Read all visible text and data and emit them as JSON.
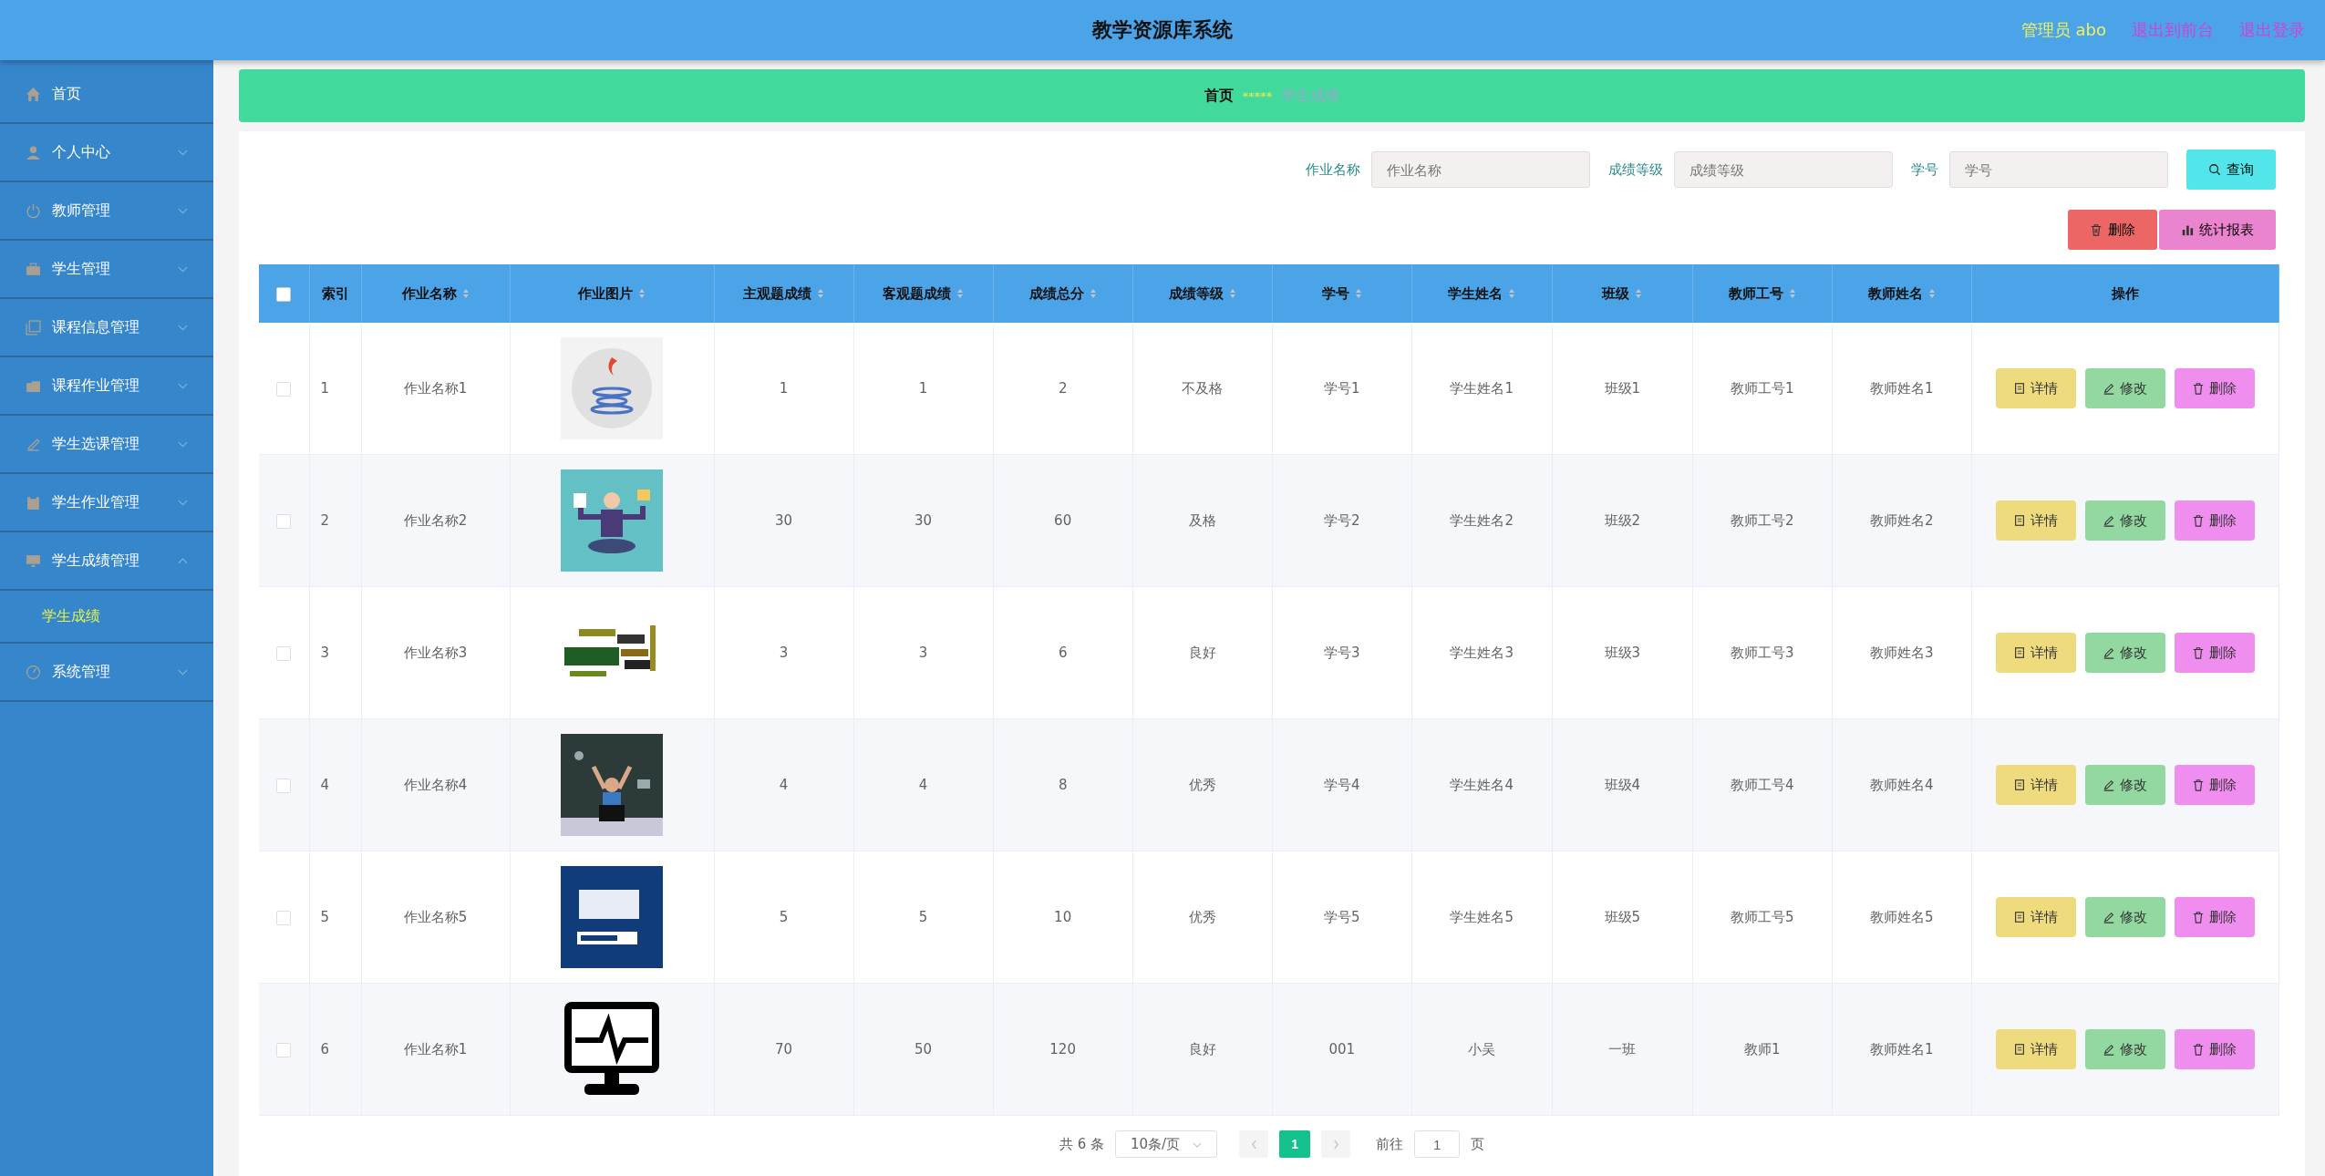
{
  "header": {
    "title": "教学资源库系统",
    "user": "管理员 abo",
    "links": [
      "退出到前台",
      "退出登录"
    ]
  },
  "sidebar": {
    "items": [
      {
        "label": "首页",
        "kind": "link"
      },
      {
        "label": "个人中心",
        "kind": "group",
        "expanded": false
      },
      {
        "label": "教师管理",
        "kind": "group",
        "expanded": false
      },
      {
        "label": "学生管理",
        "kind": "group",
        "expanded": false
      },
      {
        "label": "课程信息管理",
        "kind": "group",
        "expanded": false
      },
      {
        "label": "课程作业管理",
        "kind": "group",
        "expanded": false
      },
      {
        "label": "学生选课管理",
        "kind": "group",
        "expanded": false
      },
      {
        "label": "学生作业管理",
        "kind": "group",
        "expanded": false
      },
      {
        "label": "学生成绩管理",
        "kind": "group",
        "expanded": true,
        "children": [
          {
            "label": "学生成绩",
            "selected": true
          }
        ]
      },
      {
        "label": "系统管理",
        "kind": "group",
        "expanded": false
      }
    ]
  },
  "breadcrumb": {
    "home": "首页",
    "separator": "*****",
    "current": "学生成绩"
  },
  "search": {
    "fields": [
      {
        "label": "作业名称",
        "placeholder": "作业名称"
      },
      {
        "label": "成绩等级",
        "placeholder": "成绩等级"
      },
      {
        "label": "学号",
        "placeholder": "学号"
      }
    ],
    "button": "查询"
  },
  "toolbar": {
    "delete": "删除",
    "report": "统计报表"
  },
  "table": {
    "select_all": {
      "checked": false
    },
    "columns": [
      {
        "label": "索引",
        "sortable": false
      },
      {
        "label": "作业名称",
        "sortable": true
      },
      {
        "label": "作业图片",
        "sortable": true
      },
      {
        "label": "主观题成绩",
        "sortable": true
      },
      {
        "label": "客观题成绩",
        "sortable": true
      },
      {
        "label": "成绩总分",
        "sortable": true
      },
      {
        "label": "成绩等级",
        "sortable": true
      },
      {
        "label": "学号",
        "sortable": true
      },
      {
        "label": "学生姓名",
        "sortable": true
      },
      {
        "label": "班级",
        "sortable": true
      },
      {
        "label": "教师工号",
        "sortable": true
      },
      {
        "label": "教师姓名",
        "sortable": true
      },
      {
        "label": "操作",
        "sortable": false
      }
    ],
    "rows": [
      {
        "checked": false,
        "cells": [
          "1",
          "作业名称1",
          {
            "kind": "picture"
          },
          "1",
          "1",
          "2",
          "不及格",
          "学号1",
          "学生姓名1",
          "班级1",
          "教师工号1",
          "教师姓名1"
        ],
        "actions": [
          "详情",
          "修改",
          "删除"
        ]
      },
      {
        "checked": false,
        "cells": [
          "2",
          "作业名称2",
          {
            "kind": "picture"
          },
          "30",
          "30",
          "60",
          "及格",
          "学号2",
          "学生姓名2",
          "班级2",
          "教师工号2",
          "教师姓名2"
        ],
        "actions": [
          "详情",
          "修改",
          "删除"
        ]
      },
      {
        "checked": false,
        "cells": [
          "3",
          "作业名称3",
          {
            "kind": "picture"
          },
          "3",
          "3",
          "6",
          "良好",
          "学号3",
          "学生姓名3",
          "班级3",
          "教师工号3",
          "教师姓名3"
        ],
        "actions": [
          "详情",
          "修改",
          "删除"
        ]
      },
      {
        "checked": false,
        "cells": [
          "4",
          "作业名称4",
          {
            "kind": "picture"
          },
          "4",
          "4",
          "8",
          "优秀",
          "学号4",
          "学生姓名4",
          "班级4",
          "教师工号4",
          "教师姓名4"
        ],
        "actions": [
          "详情",
          "修改",
          "删除"
        ]
      },
      {
        "checked": false,
        "cells": [
          "5",
          "作业名称5",
          {
            "kind": "picture"
          },
          "5",
          "5",
          "10",
          "优秀",
          "学号5",
          "学生姓名5",
          "班级5",
          "教师工号5",
          "教师姓名5"
        ],
        "actions": [
          "详情",
          "修改",
          "删除"
        ]
      },
      {
        "checked": false,
        "cells": [
          "6",
          "作业名称1",
          {
            "kind": "picture"
          },
          "70",
          "50",
          "120",
          "良好",
          "001",
          "小吴",
          "一班",
          "教师1",
          "教师姓名1"
        ],
        "actions": [
          "详情",
          "修改",
          "删除"
        ]
      }
    ]
  },
  "pagination": {
    "total": "共 6 条",
    "page_size": "10条/页",
    "pages": [
      {
        "label": "1",
        "selected": true
      }
    ],
    "goto": "前往",
    "goto_value": "1",
    "suffix": "页"
  }
}
